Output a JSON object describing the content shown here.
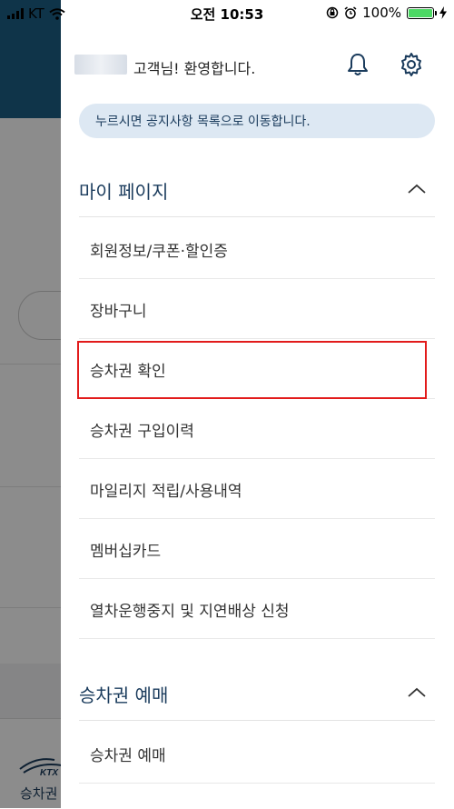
{
  "status_bar": {
    "carrier": "KT",
    "time": "오전 10:53",
    "battery": "100%",
    "battery_level": 1.0
  },
  "background_app": {
    "bottom_tab_label": "승차권"
  },
  "drawer": {
    "welcome": "고객님! 환영합니다.",
    "icons": [
      "bell-icon",
      "gear-icon"
    ],
    "notice": "누르시면 공지사항 목록으로 이동합니다.",
    "sections": [
      {
        "title": "마이 페이지",
        "expanded": true,
        "items": [
          "회원정보/쿠폰·할인증",
          "장바구니",
          "승차권 확인",
          "승차권 구입이력",
          "마일리지 적립/사용내역",
          "멤버십카드",
          "열차운행중지 및 지연배상 신청"
        ]
      },
      {
        "title": "승차권 예매",
        "expanded": true,
        "items": [
          "승차권 예매"
        ]
      }
    ],
    "highlighted_item": "승차권 확인"
  },
  "colors": {
    "accent": "#1a3b5c",
    "notice_bg": "#dde8f3",
    "highlight": "#e21b1b",
    "battery": "#4cd964"
  }
}
